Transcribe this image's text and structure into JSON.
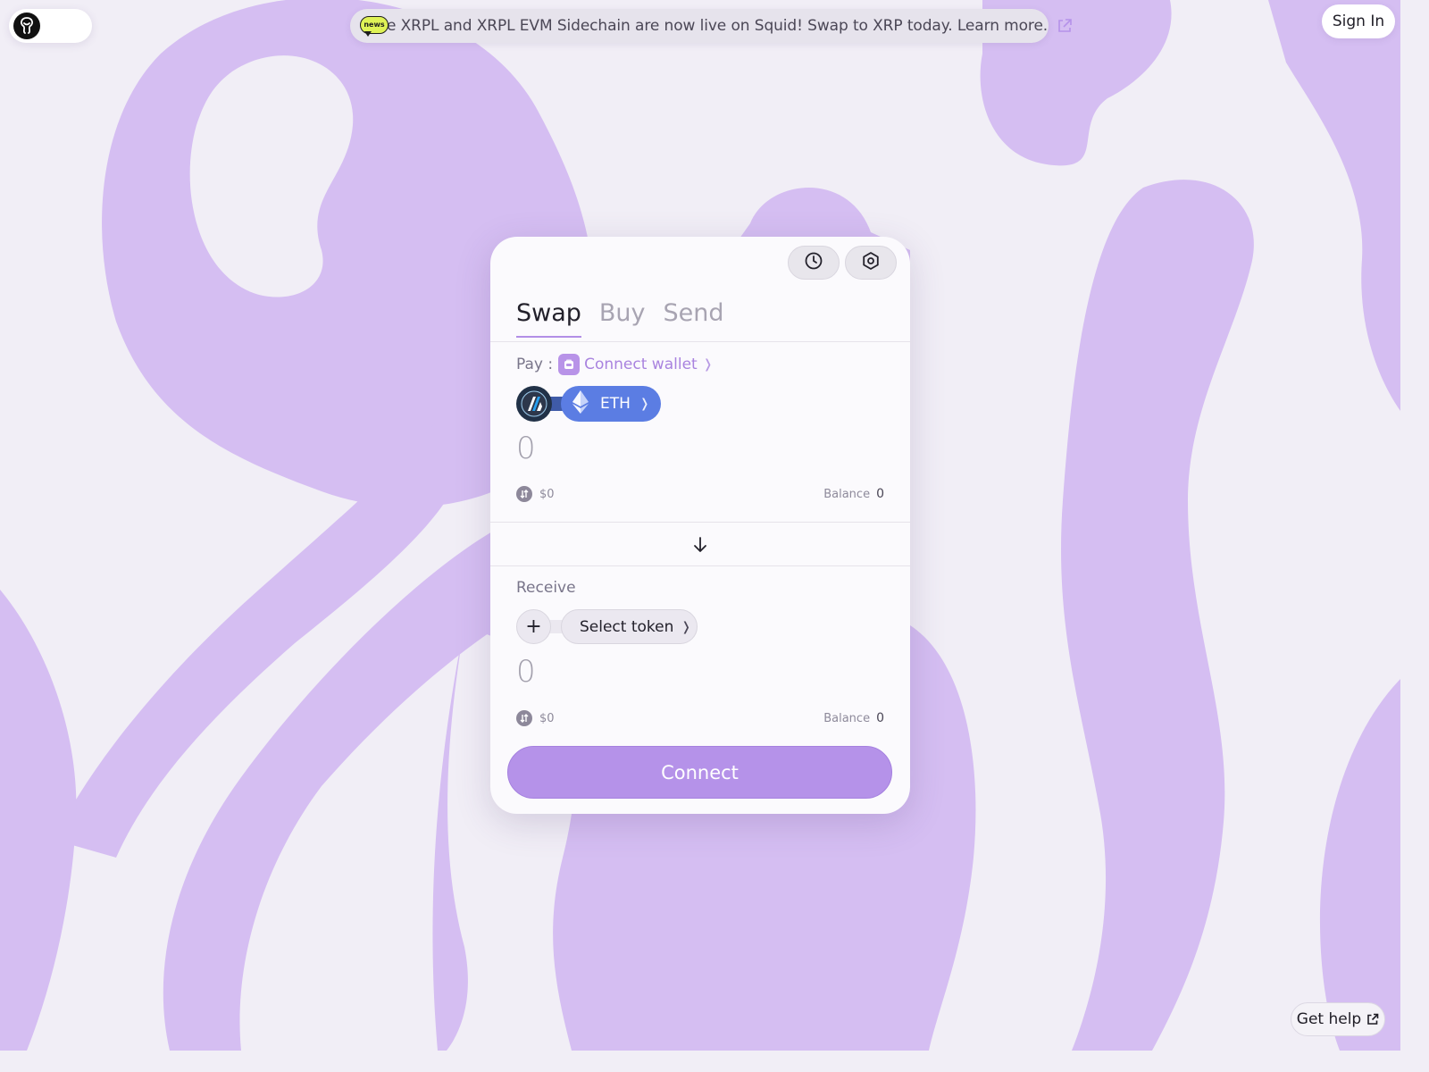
{
  "header": {
    "news_badge": "news",
    "news_text": "The XRPL and XRPL EVM Sidechain are now live on Squid! Swap to XRP today. Learn more.",
    "sign_in_label": "Sign In"
  },
  "widget": {
    "tabs": [
      {
        "label": "Swap",
        "active": true
      },
      {
        "label": "Buy",
        "active": false
      },
      {
        "label": "Send",
        "active": false
      }
    ],
    "toolbar_icons": [
      "history-icon",
      "settings-icon"
    ],
    "pay": {
      "label": "Pay :",
      "connect_wallet_label": "Connect wallet",
      "chain_icon": "arbitrum-icon",
      "token_icon": "ethereum-icon",
      "token": "ETH",
      "amount": "0",
      "usd_value": "$0",
      "balance_label": "Balance",
      "balance_value": "0"
    },
    "direction_icon": "arrow-down-icon",
    "receive": {
      "label": "Receive",
      "select_token_label": "Select token",
      "amount": "0",
      "usd_value": "$0",
      "balance_label": "Balance",
      "balance_value": "0"
    },
    "connect_button_label": "Connect"
  },
  "footer": {
    "help_label": "Get help"
  },
  "colors": {
    "background": "#f1eef6",
    "blob": "#d5bef2",
    "accent": "#b592e9",
    "eth_pill": "#5b7de3",
    "news_badge": "#dff256"
  }
}
